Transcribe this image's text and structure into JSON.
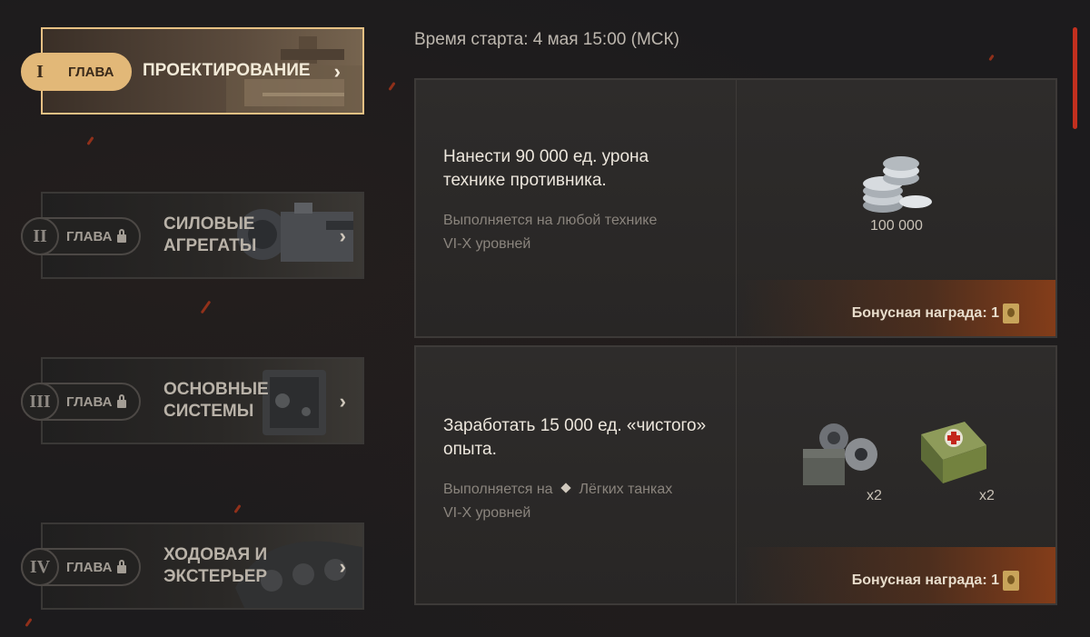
{
  "start_time": "Время старта: 4 мая 15:00 (МСК)",
  "chapters": [
    {
      "num": "I",
      "label": "ГЛАВА",
      "title": "ПРОЕКТИРОВАНИЕ",
      "locked": false,
      "active": true
    },
    {
      "num": "II",
      "label": "ГЛАВА",
      "title_line1": "СИЛОВЫЕ",
      "title_line2": "АГРЕГАТЫ",
      "locked": true
    },
    {
      "num": "III",
      "label": "ГЛАВА",
      "title_line1": "ОСНОВНЫЕ",
      "title_line2": "СИСТЕМЫ",
      "locked": true
    },
    {
      "num": "IV",
      "label": "ГЛАВА",
      "title_line1": "ХОДОВАЯ И",
      "title_line2": "ЭКСТЕРЬЕР",
      "locked": true
    }
  ],
  "chevron": "›",
  "tasks": [
    {
      "main_line1": "Нанести 90 000 ед. урона",
      "main_line2": "технике противника.",
      "sub_line1": "Выполняется на любой технике",
      "sub_line2": "VI-X уровней",
      "reward_amount": "100 000",
      "reward_icon": "silver-coins-icon",
      "bonus": "Бонусная награда: 1"
    },
    {
      "main_line1": "Заработать 15 000 ед. «чистого»",
      "main_line2": "опыта.",
      "sub_line1": "Выполняется на",
      "sub_vehicle": "Лёгких танках",
      "sub_line2": "VI-X уровней",
      "reward1_count": "x2",
      "reward1_icon": "equipment-crate-icon",
      "reward2_count": "x2",
      "reward2_icon": "first-aid-kit-icon",
      "bonus": "Бонусная награда: 1"
    }
  ],
  "colors": {
    "accent": "#e2b878",
    "scroll": "#c2301f"
  }
}
